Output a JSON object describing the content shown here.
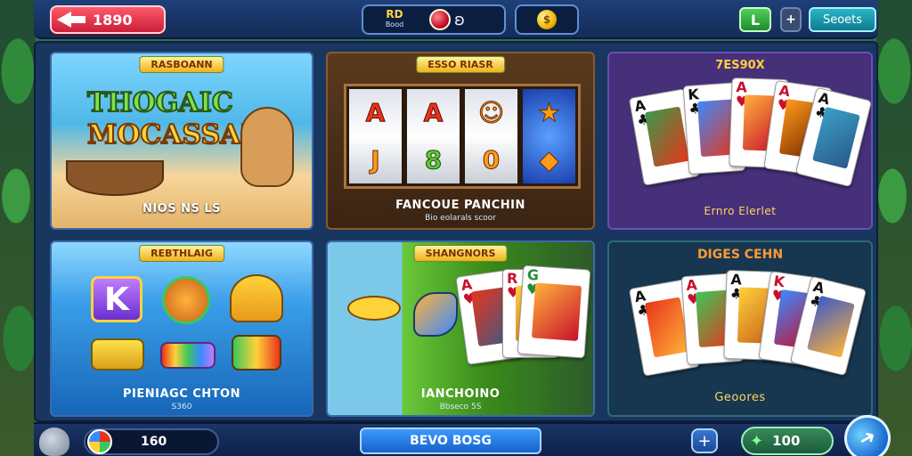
{
  "topbar": {
    "back_label": "1890",
    "coins": {
      "amount": "RD",
      "caption": "Bood",
      "link": "ʚ"
    },
    "gold_symbol": "$",
    "check_symbol": "L",
    "plus_symbol": "+",
    "settings_label": "Seoets"
  },
  "games": [
    {
      "ribbon": "RASBOANN",
      "logo_line1": "THOGAIC",
      "logo_line2": "MOCASSAI",
      "label": "NIOS NS LS"
    },
    {
      "ribbon": "ESSO RIASR",
      "label": "FANCOUE PANCHIN",
      "sub": "Bio eolarals scoor",
      "reels": [
        [
          "A",
          "J"
        ],
        [
          "A",
          "8"
        ],
        [
          "☺",
          "0"
        ],
        [
          "★",
          "◆"
        ]
      ]
    },
    {
      "title": "7ES90X",
      "label": "Ernro Elerlet"
    },
    {
      "ribbon": "REBTHLAIG",
      "k_symbol": "K",
      "label": "PIENIAGC CHTON",
      "sub": "S360"
    },
    {
      "ribbon": "SHANGNORS",
      "label": "IANCHOINO",
      "sub": "Bbseco 5S"
    },
    {
      "title": "DIGES CEHN",
      "label": "Geoores"
    }
  ],
  "bottombar": {
    "profile_value": "160",
    "play_label": "BEVO BOSG",
    "add_symbol": "+",
    "cash_value": "100",
    "cash_symbol": "✦",
    "go_symbol": "➜"
  },
  "icons": [
    "back-arrow-icon",
    "ruby-icon",
    "link-icon",
    "coin-icon",
    "check-icon",
    "mascot-icon",
    "ball-icon",
    "star-icon",
    "go-icon"
  ],
  "colors": {
    "accent": "#1e3f78",
    "back_button": "#e0304a",
    "gold": "#ffd34a",
    "play_button": "#2a7de8"
  }
}
